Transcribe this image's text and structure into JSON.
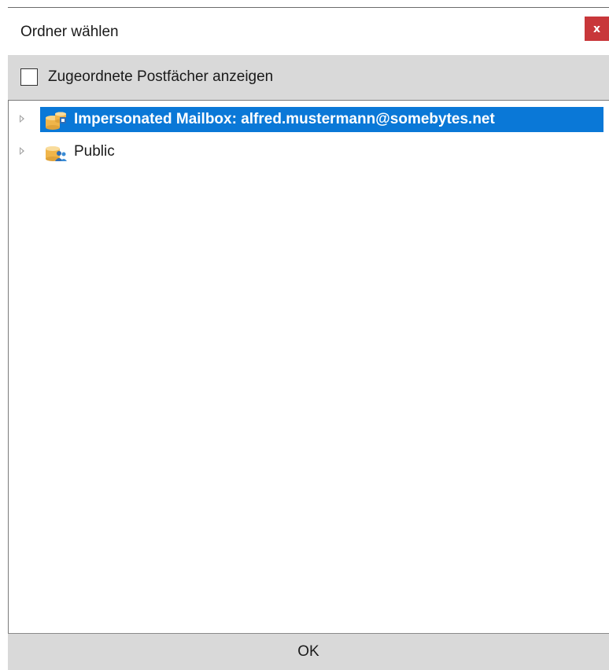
{
  "dialog": {
    "title": "Ordner wählen",
    "close_label": "x"
  },
  "options": {
    "show_mailboxes_label": "Zugeordnete Postfächer anzeigen",
    "show_mailboxes_checked": false
  },
  "tree": {
    "nodes": [
      {
        "label": "Impersonated Mailbox: alfred.mustermann@somebytes.net",
        "icon": "mailbox-database-icon",
        "selected": true,
        "expanded": false
      },
      {
        "label": "Public",
        "icon": "public-folder-database-icon",
        "selected": false,
        "expanded": false
      }
    ]
  },
  "footer": {
    "ok_label": "OK"
  },
  "colors": {
    "selection": "#0a78d7",
    "close_button": "#c8373a",
    "bar_background": "#d9d9d9"
  }
}
